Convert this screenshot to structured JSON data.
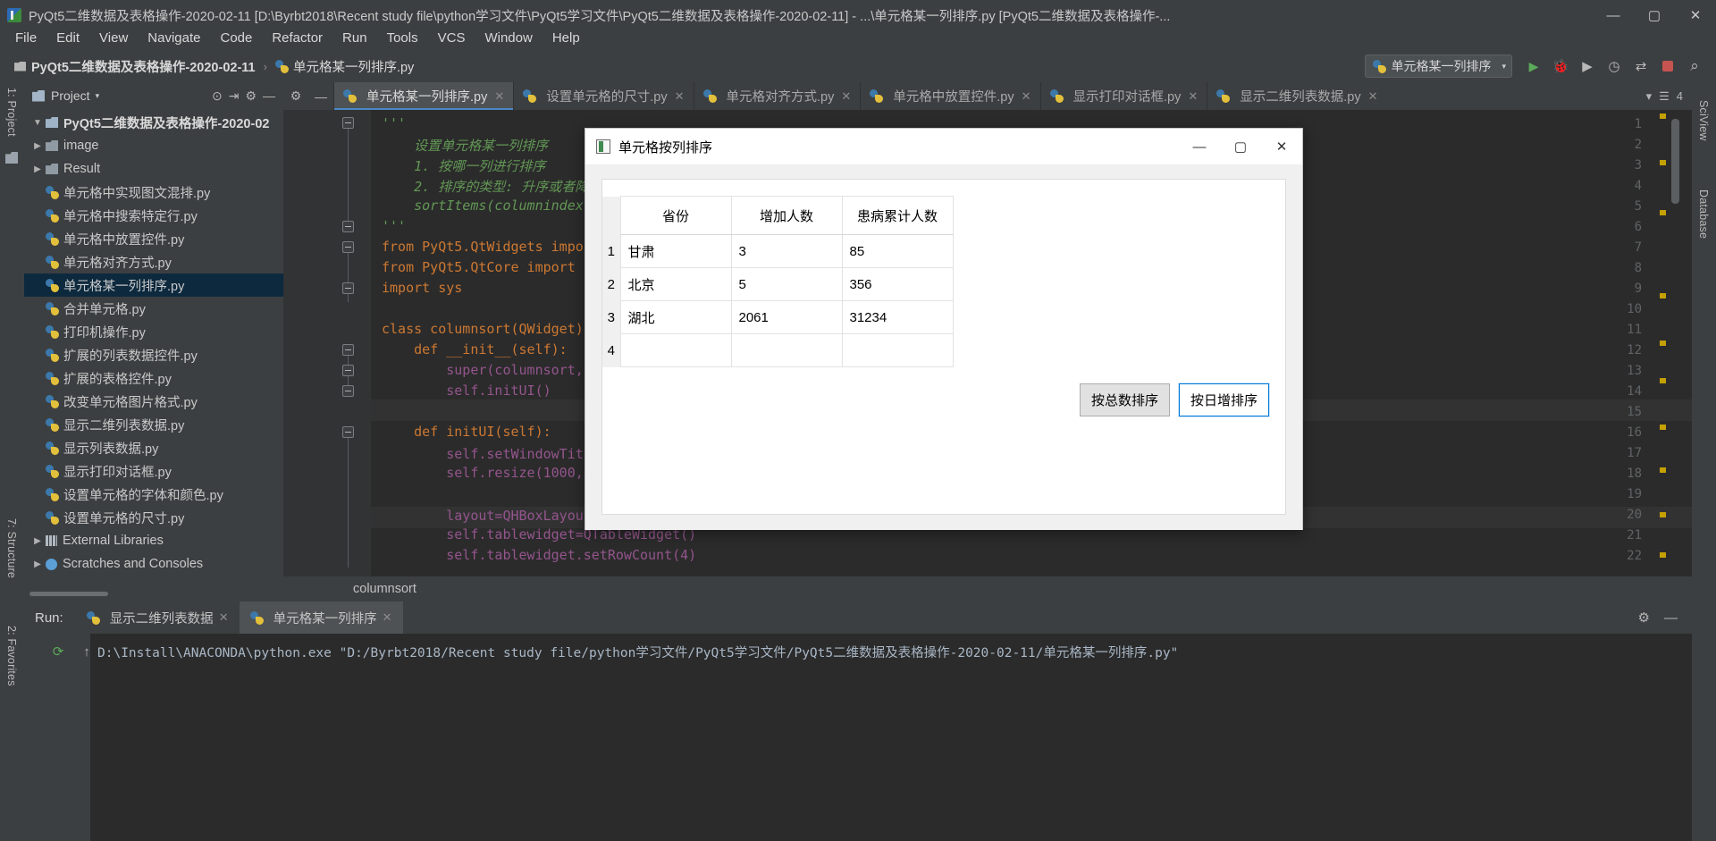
{
  "window": {
    "title": "PyQt5二维数据及表格操作-2020-02-11 [D:\\Byrbt2018\\Recent study file\\python学习文件\\PyQt5学习文件\\PyQt5二维数据及表格操作-2020-02-11] - ...\\单元格某一列排序.py [PyQt5二维数据及表格操作-...",
    "minimize": "—",
    "maximize": "▢",
    "close": "✕"
  },
  "menu": {
    "items": [
      "File",
      "Edit",
      "View",
      "Navigate",
      "Code",
      "Refactor",
      "Run",
      "Tools",
      "VCS",
      "Window",
      "Help"
    ]
  },
  "navbar": {
    "crumb_project": "PyQt5二维数据及表格操作-2020-02-11",
    "crumb_sep": "›",
    "crumb_file": "单元格某一列排序.py",
    "run_config": "单元格某一列排序",
    "run_config_caret": "▾",
    "icons": [
      "run-icon",
      "debug-icon",
      "run-coverage-icon",
      "profile-icon",
      "attach-icon",
      "stop-icon",
      "search-icon"
    ]
  },
  "strips": {
    "left_top": "1: Project",
    "left_structure": "7: Structure",
    "left_favorites": "2: Favorites",
    "right_sciview": "SciView",
    "right_database": "Database"
  },
  "project_panel": {
    "title": "Project",
    "caret": "▾",
    "tools": [
      "target-icon",
      "collapse-icon",
      "settings-icon",
      "hide-icon"
    ]
  },
  "tree": {
    "items": [
      {
        "label": "PyQt5二维数据及表格操作-2020-02",
        "indent": 0,
        "arrow": "▼",
        "icon": "folder-icon",
        "bold": true,
        "selected": false
      },
      {
        "label": "image",
        "indent": 1,
        "arrow": "▶",
        "icon": "folder-icon",
        "bold": false,
        "selected": false
      },
      {
        "label": "Result",
        "indent": 1,
        "arrow": "▶",
        "icon": "folder-icon",
        "bold": false,
        "selected": false
      },
      {
        "label": "单元格中实现图文混排.py",
        "indent": 2,
        "arrow": "",
        "icon": "python-file-icon",
        "bold": false,
        "selected": false
      },
      {
        "label": "单元格中搜索特定行.py",
        "indent": 2,
        "arrow": "",
        "icon": "python-file-icon",
        "bold": false,
        "selected": false
      },
      {
        "label": "单元格中放置控件.py",
        "indent": 2,
        "arrow": "",
        "icon": "python-file-icon",
        "bold": false,
        "selected": false
      },
      {
        "label": "单元格对齐方式.py",
        "indent": 2,
        "arrow": "",
        "icon": "python-file-icon",
        "bold": false,
        "selected": false
      },
      {
        "label": "单元格某一列排序.py",
        "indent": 2,
        "arrow": "",
        "icon": "python-file-icon",
        "bold": false,
        "selected": true
      },
      {
        "label": "合并单元格.py",
        "indent": 2,
        "arrow": "",
        "icon": "python-file-icon",
        "bold": false,
        "selected": false
      },
      {
        "label": "打印机操作.py",
        "indent": 2,
        "arrow": "",
        "icon": "python-file-icon",
        "bold": false,
        "selected": false
      },
      {
        "label": "扩展的列表数据控件.py",
        "indent": 2,
        "arrow": "",
        "icon": "python-file-icon",
        "bold": false,
        "selected": false
      },
      {
        "label": "扩展的表格控件.py",
        "indent": 2,
        "arrow": "",
        "icon": "python-file-icon",
        "bold": false,
        "selected": false
      },
      {
        "label": "改变单元格图片格式.py",
        "indent": 2,
        "arrow": "",
        "icon": "python-file-icon",
        "bold": false,
        "selected": false
      },
      {
        "label": "显示二维列表数据.py",
        "indent": 2,
        "arrow": "",
        "icon": "python-file-icon",
        "bold": false,
        "selected": false
      },
      {
        "label": "显示列表数据.py",
        "indent": 2,
        "arrow": "",
        "icon": "python-file-icon",
        "bold": false,
        "selected": false
      },
      {
        "label": "显示打印对话框.py",
        "indent": 2,
        "arrow": "",
        "icon": "python-file-icon",
        "bold": false,
        "selected": false
      },
      {
        "label": "设置单元格的字体和颜色.py",
        "indent": 2,
        "arrow": "",
        "icon": "python-file-icon",
        "bold": false,
        "selected": false
      },
      {
        "label": "设置单元格的尺寸.py",
        "indent": 2,
        "arrow": "",
        "icon": "python-file-icon",
        "bold": false,
        "selected": false
      },
      {
        "label": "External Libraries",
        "indent": 0,
        "arrow": "▶",
        "icon": "library-icon",
        "bold": false,
        "selected": false
      },
      {
        "label": "Scratches and Consoles",
        "indent": 0,
        "arrow": "▶",
        "icon": "scratch-icon",
        "bold": false,
        "selected": false
      }
    ]
  },
  "tabs": {
    "items": [
      {
        "label": "单元格某一列排序.py",
        "active": true,
        "close": "✕"
      },
      {
        "label": "设置单元格的尺寸.py",
        "active": false,
        "close": "✕"
      },
      {
        "label": "单元格对齐方式.py",
        "active": false,
        "close": "✕"
      },
      {
        "label": "单元格中放置控件.py",
        "active": false,
        "close": "✕"
      },
      {
        "label": "显示打印对话框.py",
        "active": false,
        "close": "✕"
      },
      {
        "label": "显示二维列表数据.py",
        "active": false,
        "close": "✕"
      }
    ],
    "overflow_count": "4",
    "overflow_caret": "▾"
  },
  "editor": {
    "lines": [
      {
        "n": "1",
        "text": "'''"
      },
      {
        "n": "2",
        "text": "    设置单元格某一列排序"
      },
      {
        "n": "3",
        "text": "    1. 按哪一列进行排序"
      },
      {
        "n": "4",
        "text": "    2. 排序的类型: 升序或者降序"
      },
      {
        "n": "5",
        "text": "    sortItems(columnindex, orderType)"
      },
      {
        "n": "6",
        "text": "'''"
      },
      {
        "n": "7",
        "text": "from PyQt5.QtWidgets import *"
      },
      {
        "n": "8",
        "text": "from PyQt5.QtCore import *"
      },
      {
        "n": "9",
        "text": "import sys"
      },
      {
        "n": "10",
        "text": ""
      },
      {
        "n": "11",
        "text": "class columnsort(QWidget):"
      },
      {
        "n": "12",
        "text": "    def __init__(self):"
      },
      {
        "n": "13",
        "text": "        super(columnsort,self)."
      },
      {
        "n": "14",
        "text": "        self.initUI()"
      },
      {
        "n": "15",
        "text": ""
      },
      {
        "n": "16",
        "text": "    def initUI(self):"
      },
      {
        "n": "17",
        "text": "        self.setWindowTitle(\"单元"
      },
      {
        "n": "18",
        "text": "        self.resize(1000,500)"
      },
      {
        "n": "19",
        "text": ""
      },
      {
        "n": "20",
        "text": "        layout=QHBoxLayout()  #创"
      },
      {
        "n": "21",
        "text": "        self.tablewidget=QTableWidget()"
      },
      {
        "n": "22",
        "text": "        self.tablewidget.setRowCount(4)"
      }
    ]
  },
  "breadcrumb2": {
    "text": "columnsort"
  },
  "run_panel": {
    "label": "Run:",
    "tabs": [
      {
        "label": "显示二维列表数据",
        "active": false,
        "close": "✕"
      },
      {
        "label": "单元格某一列排序",
        "active": true,
        "close": "✕"
      }
    ],
    "settings_icon": "gear-icon",
    "minimize_icon": "—",
    "console_text": "D:\\Install\\ANACONDA\\python.exe \"D:/Byrbt2018/Recent study file/python学习文件/PyQt5学习文件/PyQt5二维数据及表格操作-2020-02-11/单元格某一列排序.py\"",
    "side_icons": [
      "rerun-icon",
      "up-icon"
    ]
  },
  "dialog": {
    "title": "单元格按列排序",
    "minimize": "—",
    "maximize": "▢",
    "close": "✕",
    "table": {
      "columns": [
        "省份",
        "增加人数",
        "患病累计人数"
      ],
      "row_numbers": [
        "1",
        "2",
        "3",
        "4"
      ],
      "rows": [
        [
          "甘肃",
          "3",
          "85"
        ],
        [
          "北京",
          "5",
          "356"
        ],
        [
          "湖北",
          "2061",
          "31234"
        ],
        [
          "",
          "",
          ""
        ]
      ]
    },
    "buttons": [
      {
        "label": "按总数排序",
        "focused": false
      },
      {
        "label": "按日增排序",
        "focused": true
      }
    ]
  }
}
